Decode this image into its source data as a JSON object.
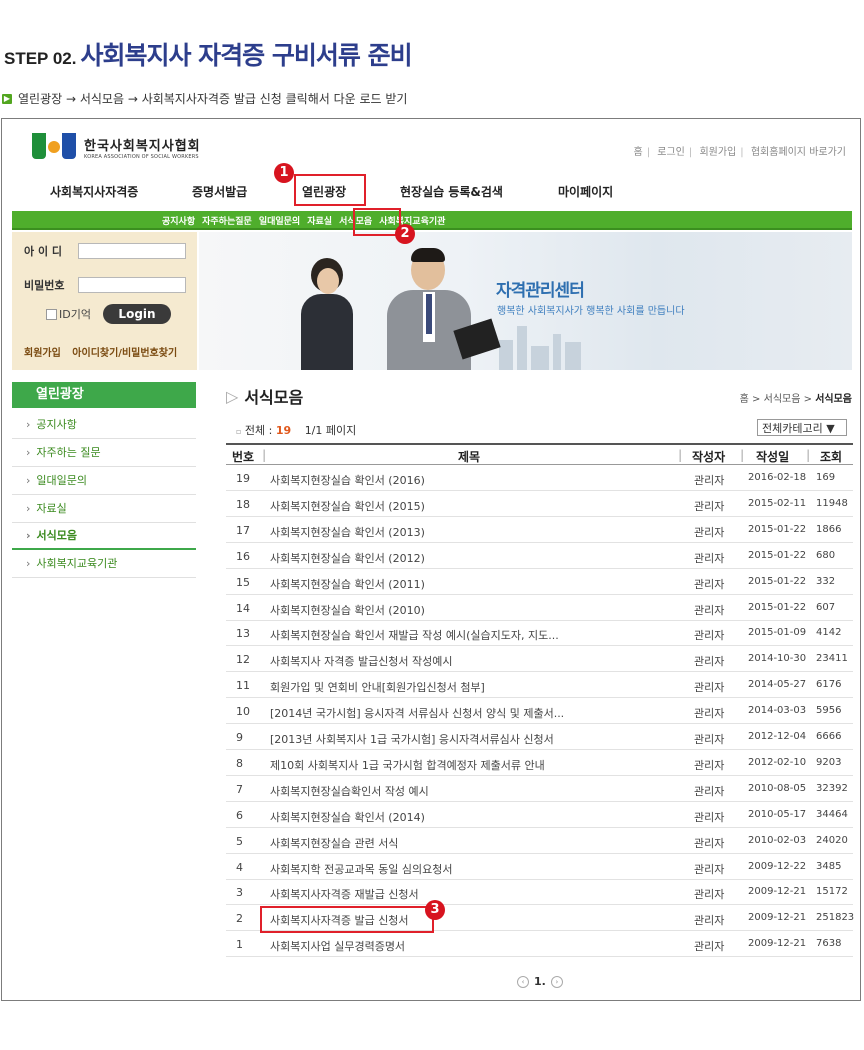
{
  "step": {
    "label": "STEP 02.",
    "heading": "사회복지사 자격증 구비서류 준비",
    "instruction": "열린광장 → 서식모음 → 사회복지사자격증 발급 신청 클릭해서 다운 로드 받기"
  },
  "site": {
    "logo_ko": "한국사회복지사협회",
    "logo_en": "KOREA ASSOCIATION OF SOCIAL WORKERS",
    "util_links": [
      "홈",
      "로그인",
      "회원가입",
      "협회홈페이지 바로가기"
    ],
    "gnb": [
      "사회복지사자격증",
      "증명서발급",
      "열린광장",
      "현장실습 등록&검색",
      "마이페이지"
    ],
    "subnav": [
      "공지사항",
      "자주하는질문",
      "일대일문의",
      "자료실",
      "서식모음",
      "사회복지교육기관"
    ]
  },
  "login": {
    "id_label": "아 이 디",
    "pw_label": "비밀번호",
    "remember_label": "ID기억",
    "login_button": "Login",
    "join_link": "회원가입",
    "find_link": "아이디찾기/비밀번호찾기"
  },
  "banner": {
    "title": "자격관리센터",
    "slogan": "행복한 사회복지사가 행복한 사회를 만듭니다"
  },
  "lnb": {
    "title": "열린광장",
    "items": [
      "공지사항",
      "자주하는 질문",
      "일대일문의",
      "자료실",
      "서식모음",
      "사회복지교육기관"
    ],
    "active_index": 4
  },
  "content": {
    "title": "서식모음",
    "breadcrumb": [
      "홈",
      "서식모음",
      "서식모음"
    ],
    "total_label": "전체 : ",
    "total_count": "19",
    "page_info": "1/1 페이지",
    "category_select": "전체카테고리 ▼",
    "columns": [
      "번호",
      "제목",
      "작성자",
      "작성일",
      "조회"
    ],
    "rows": [
      {
        "no": "19",
        "title": "사회복지현장실습 확인서 (2016)",
        "author": "관리자",
        "date": "2016-02-18",
        "views": "169"
      },
      {
        "no": "18",
        "title": "사회복지현장실습 확인서 (2015)",
        "author": "관리자",
        "date": "2015-02-11",
        "views": "11948"
      },
      {
        "no": "17",
        "title": "사회복지현장실습 확인서 (2013)",
        "author": "관리자",
        "date": "2015-01-22",
        "views": "1866"
      },
      {
        "no": "16",
        "title": "사회복지현장실습 확인서 (2012)",
        "author": "관리자",
        "date": "2015-01-22",
        "views": "680"
      },
      {
        "no": "15",
        "title": "사회복지현장실습 확인서 (2011)",
        "author": "관리자",
        "date": "2015-01-22",
        "views": "332"
      },
      {
        "no": "14",
        "title": "사회복지현장실습 확인서 (2010)",
        "author": "관리자",
        "date": "2015-01-22",
        "views": "607"
      },
      {
        "no": "13",
        "title": "사회복지현장실습 확인서 재발급 작성 예시(실습지도자, 지도...",
        "author": "관리자",
        "date": "2015-01-09",
        "views": "4142"
      },
      {
        "no": "12",
        "title": "사회복지사 자격증 발급신청서 작성예시",
        "author": "관리자",
        "date": "2014-10-30",
        "views": "23411"
      },
      {
        "no": "11",
        "title": "회원가입 및 연회비 안내[회원가입신청서 첨부]",
        "author": "관리자",
        "date": "2014-05-27",
        "views": "6176"
      },
      {
        "no": "10",
        "title": "[2014년 국가시험] 응시자격 서류심사 신청서 양식 및 제출서...",
        "author": "관리자",
        "date": "2014-03-03",
        "views": "5956"
      },
      {
        "no": "9",
        "title": "[2013년 사회복지사 1급 국가시험] 응시자격서류심사 신청서",
        "author": "관리자",
        "date": "2012-12-04",
        "views": "6666"
      },
      {
        "no": "8",
        "title": "제10회 사회복지사 1급 국가시험 합격예정자 제출서류 안내",
        "author": "관리자",
        "date": "2012-02-10",
        "views": "9203"
      },
      {
        "no": "7",
        "title": "사회복지현장실습확인서 작성 예시",
        "author": "관리자",
        "date": "2010-08-05",
        "views": "32392"
      },
      {
        "no": "6",
        "title": "사회복지현장실습 확인서 (2014)",
        "author": "관리자",
        "date": "2010-05-17",
        "views": "34464"
      },
      {
        "no": "5",
        "title": "사회복지현장실습 관련 서식",
        "author": "관리자",
        "date": "2010-02-03",
        "views": "24020"
      },
      {
        "no": "4",
        "title": "사회복지학 전공교과목 동일 심의요청서",
        "author": "관리자",
        "date": "2009-12-22",
        "views": "3485"
      },
      {
        "no": "3",
        "title": "사회복지사자격증 재발급 신청서",
        "author": "관리자",
        "date": "2009-12-21",
        "views": "15172"
      },
      {
        "no": "2",
        "title": "사회복지사자격증 발급 신청서",
        "author": "관리자",
        "date": "2009-12-21",
        "views": "251823"
      },
      {
        "no": "1",
        "title": "사회복지사업 실무경력증명서",
        "author": "관리자",
        "date": "2009-12-21",
        "views": "7638"
      }
    ],
    "pager_current": "1."
  },
  "annotations": [
    "1",
    "2",
    "3"
  ],
  "colors": {
    "heading": "#2d3e8c",
    "nav_green": "#4fae2c",
    "highlight_red": "#e0202a"
  }
}
